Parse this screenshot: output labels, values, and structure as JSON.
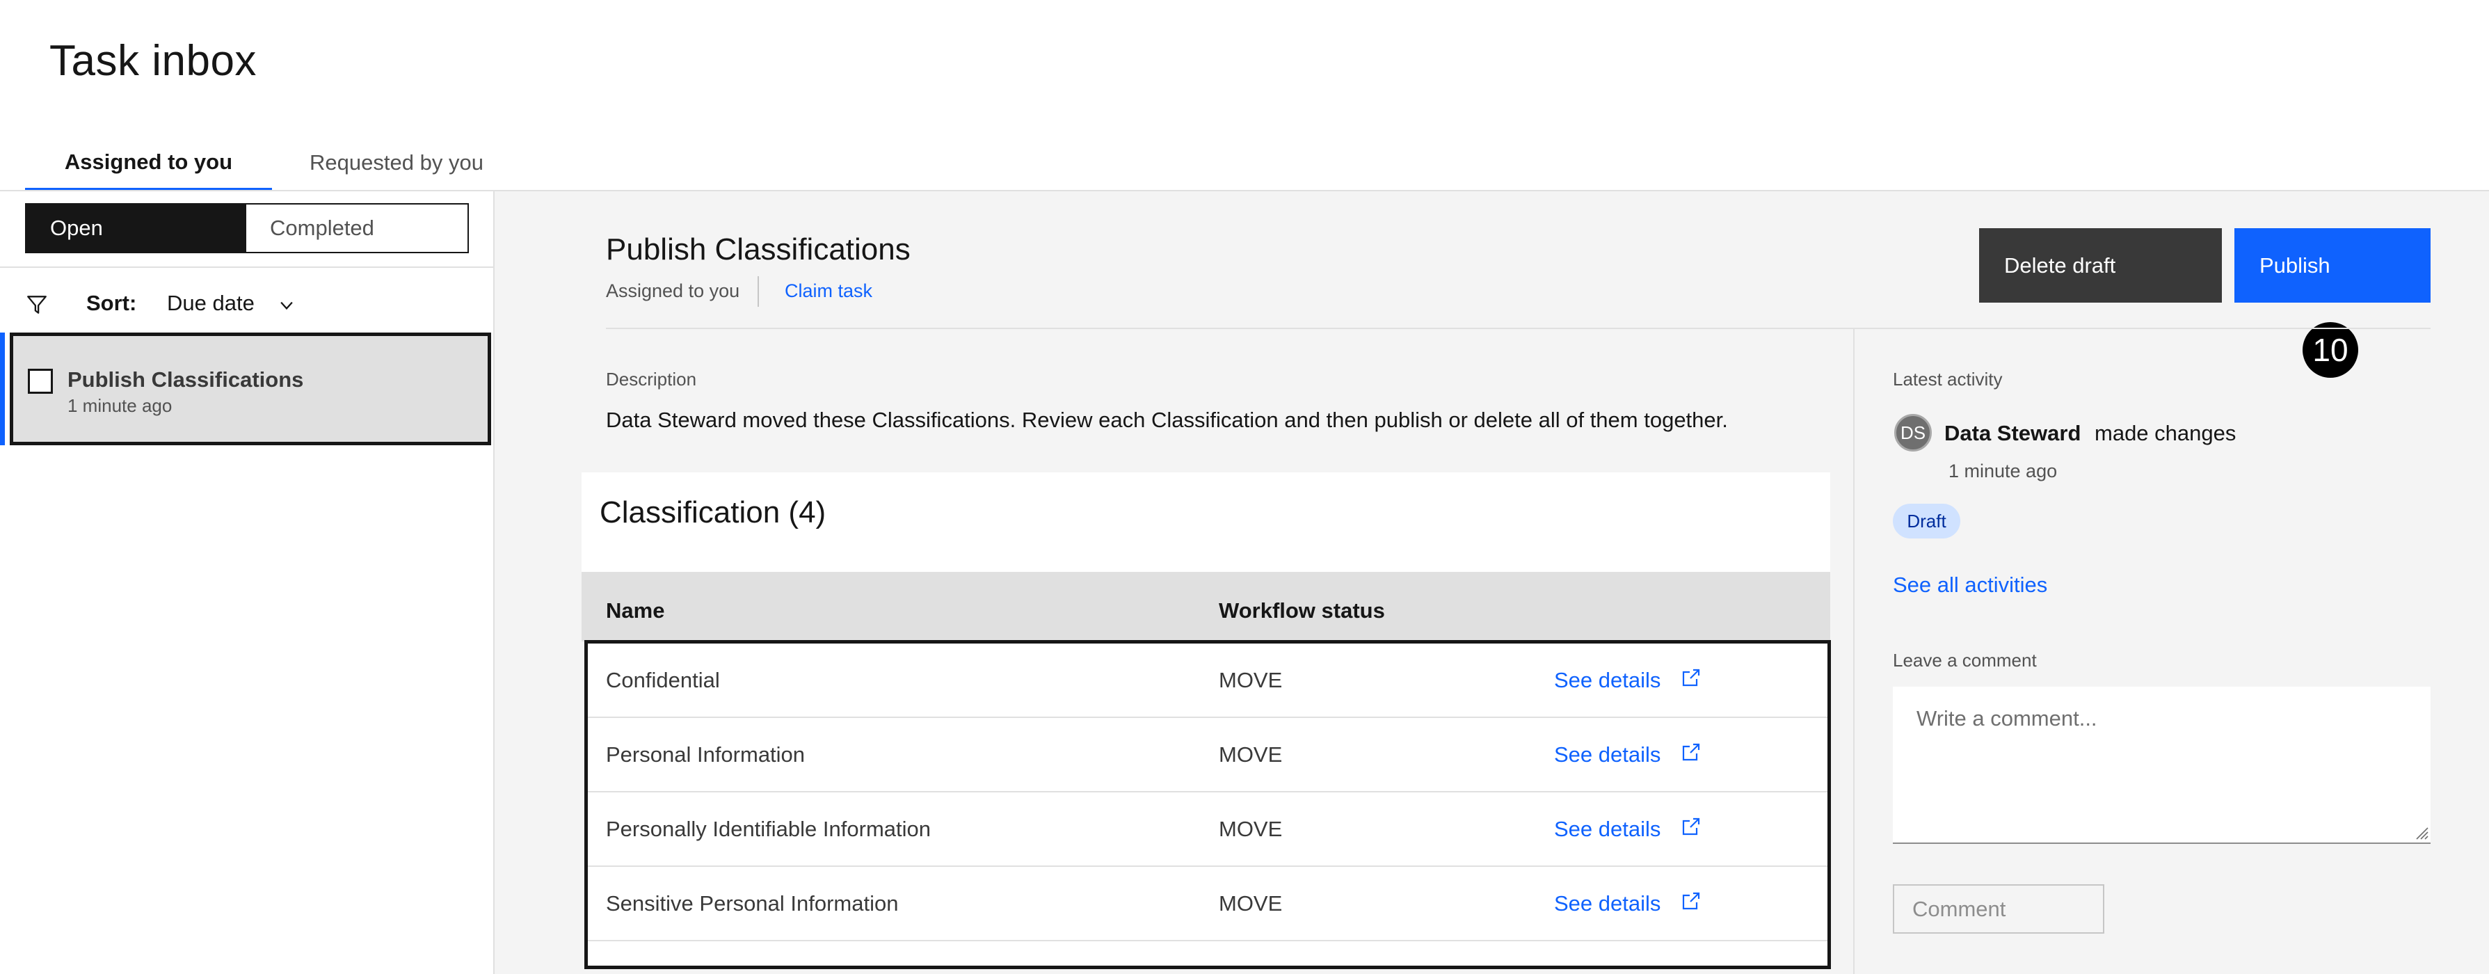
{
  "page": {
    "title": "Task inbox"
  },
  "tabs": [
    {
      "label": "Assigned to you",
      "active": true
    },
    {
      "label": "Requested by you",
      "active": false
    }
  ],
  "filter": {
    "segments": [
      {
        "label": "Open",
        "selected": true
      },
      {
        "label": "Completed",
        "selected": false
      }
    ],
    "sort_label": "Sort:",
    "sort_value": "Due date",
    "icons": {
      "filter": "filter-icon",
      "chevron": "chevron-down-icon"
    }
  },
  "task_list": [
    {
      "title": "Publish Classifications",
      "time": "1 minute ago",
      "checked": false
    }
  ],
  "detail": {
    "title": "Publish Classifications",
    "assigned": "Assigned to you",
    "claim": "Claim task",
    "delete_label": "Delete draft",
    "publish_label": "Publish",
    "step_number": "10",
    "description_label": "Description",
    "description": "Data Steward moved these Classifications. Review each Classification and then publish or delete all of them together.",
    "table_title": "Classification (4)",
    "columns": [
      "Name",
      "Workflow status"
    ],
    "rows": [
      {
        "name": "Confidential",
        "status": "MOVE",
        "link": "See details"
      },
      {
        "name": "Personal Information",
        "status": "MOVE",
        "link": "See details"
      },
      {
        "name": "Personally Identifiable Information",
        "status": "MOVE",
        "link": "See details"
      },
      {
        "name": "Sensitive Personal Information",
        "status": "MOVE",
        "link": "See details"
      }
    ]
  },
  "activity": {
    "label": "Latest activity",
    "avatar_initials": "DS",
    "user": "Data Steward",
    "action": "made changes",
    "time": "1 minute ago",
    "tag": "Draft",
    "see_all": "See all activities",
    "comment_label": "Leave a comment",
    "comment_placeholder": "Write a comment...",
    "comment_button": "Comment"
  },
  "colors": {
    "accent": "#0f62fe",
    "dark": "#161616",
    "tag_bg": "#d0e2ff"
  }
}
